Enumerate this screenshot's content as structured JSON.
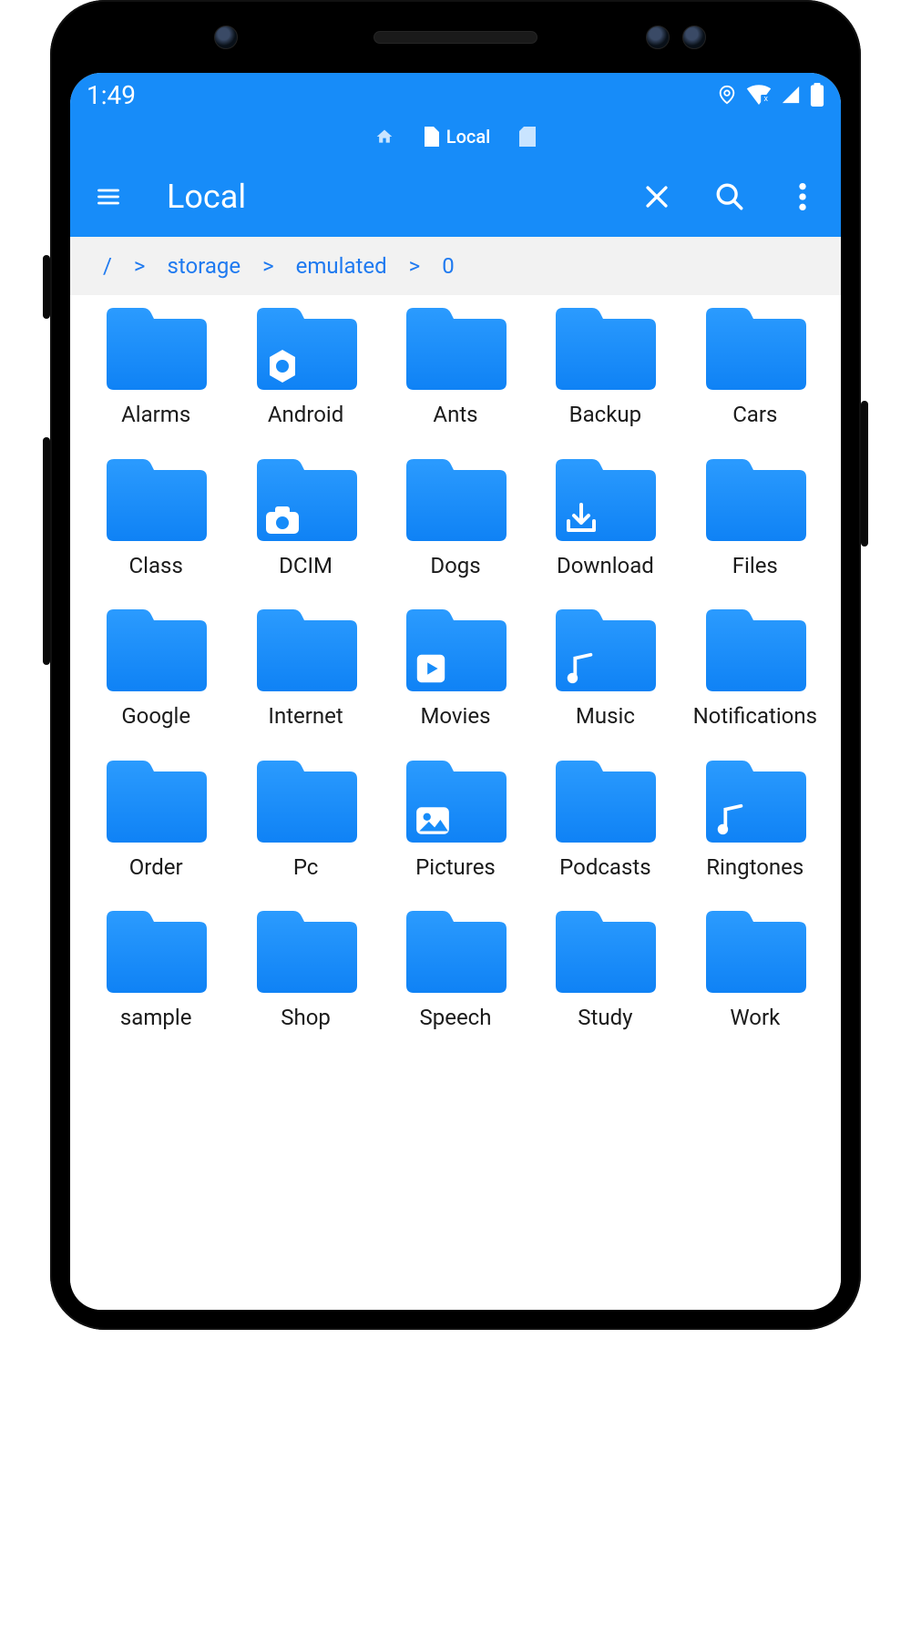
{
  "status": {
    "time": "1:49"
  },
  "tabs": {
    "active_label": "Local"
  },
  "header": {
    "title": "Local"
  },
  "breadcrumb": {
    "root": "/",
    "sep": ">",
    "parts": [
      "storage",
      "emulated",
      "0"
    ]
  },
  "folders": [
    {
      "name": "Alarms",
      "badge": ""
    },
    {
      "name": "Android",
      "badge": "gear"
    },
    {
      "name": "Ants",
      "badge": ""
    },
    {
      "name": "Backup",
      "badge": ""
    },
    {
      "name": "Cars",
      "badge": ""
    },
    {
      "name": "Class",
      "badge": ""
    },
    {
      "name": "DCIM",
      "badge": "camera"
    },
    {
      "name": "Dogs",
      "badge": ""
    },
    {
      "name": "Download",
      "badge": "download"
    },
    {
      "name": "Files",
      "badge": ""
    },
    {
      "name": "Google",
      "badge": ""
    },
    {
      "name": "Internet",
      "badge": ""
    },
    {
      "name": "Movies",
      "badge": "play"
    },
    {
      "name": "Music",
      "badge": "music"
    },
    {
      "name": "Notifications",
      "badge": ""
    },
    {
      "name": "Order",
      "badge": ""
    },
    {
      "name": "Pc",
      "badge": ""
    },
    {
      "name": "Pictures",
      "badge": "image"
    },
    {
      "name": "Podcasts",
      "badge": ""
    },
    {
      "name": "Ringtones",
      "badge": "music"
    },
    {
      "name": "sample",
      "badge": ""
    },
    {
      "name": "Shop",
      "badge": ""
    },
    {
      "name": "Speech",
      "badge": ""
    },
    {
      "name": "Study",
      "badge": ""
    },
    {
      "name": "Work",
      "badge": ""
    }
  ]
}
